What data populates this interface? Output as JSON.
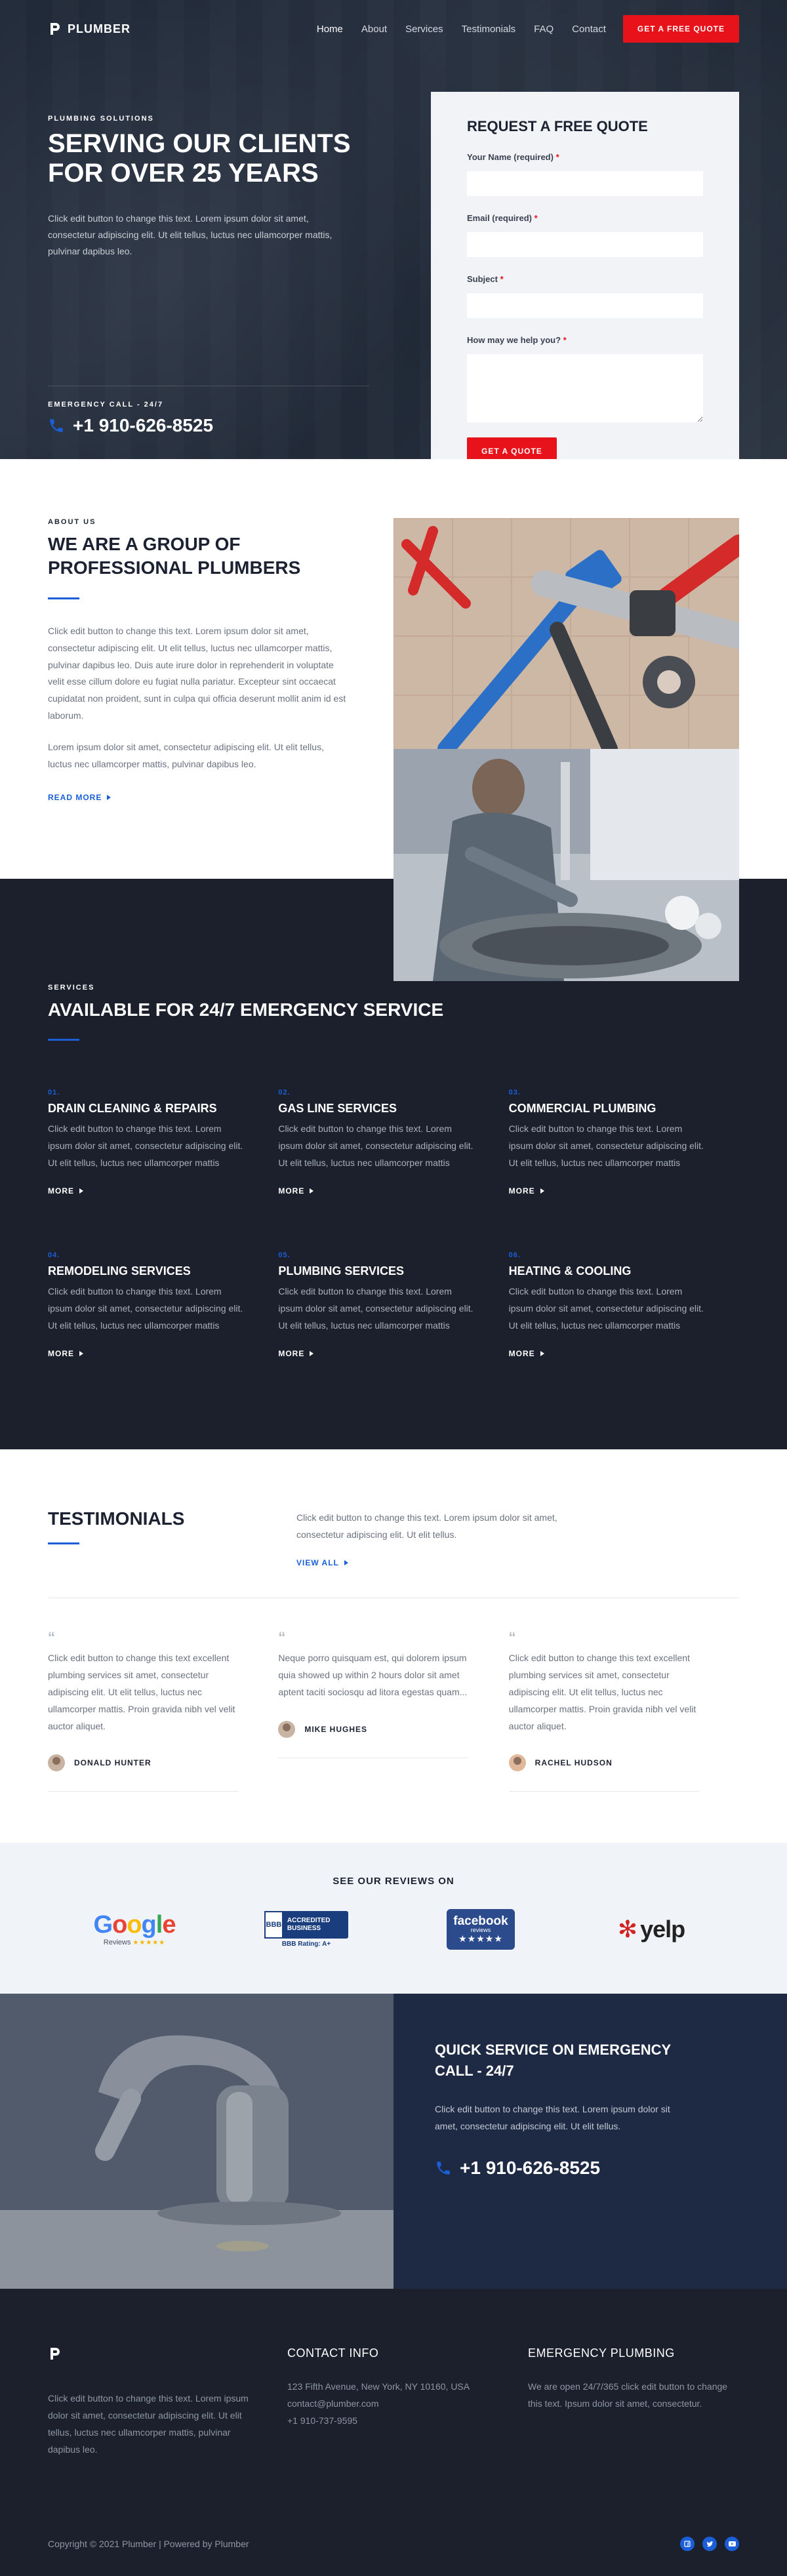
{
  "nav": {
    "brand": "PLUMBER",
    "links": [
      "Home",
      "About",
      "Services",
      "Testimonials",
      "FAQ",
      "Contact"
    ],
    "cta": "GET A FREE QUOTE"
  },
  "hero": {
    "eyebrow": "PLUMBING SOLUTIONS",
    "title": "SERVING OUR CLIENTS FOR OVER 25 YEARS",
    "text": "Click edit button to change this text. Lorem ipsum dolor sit amet, consectetur adipiscing elit. Ut elit tellus, luctus nec ullamcorper mattis, pulvinar dapibus leo.",
    "call_label": "EMERGENCY CALL - 24/7",
    "phone": "+1 910-626-8525"
  },
  "quote_form": {
    "title": "REQUEST A FREE QUOTE",
    "fields": [
      {
        "label": "Your Name (required)",
        "req": "*"
      },
      {
        "label": "Email (required)",
        "req": "*"
      },
      {
        "label": "Subject",
        "req": "*"
      },
      {
        "label": "How may we help you?",
        "req": "*"
      }
    ],
    "submit": "GET A QUOTE"
  },
  "about": {
    "eyebrow": "ABOUT US",
    "title": "WE ARE A GROUP OF PROFESSIONAL PLUMBERS",
    "p1": "Click edit button to change this text. Lorem ipsum dolor sit amet, consectetur adipiscing elit. Ut elit tellus, luctus nec ullamcorper mattis, pulvinar dapibus leo. Duis aute irure dolor in reprehenderit in voluptate velit esse cillum dolore eu fugiat nulla pariatur. Excepteur sint occaecat cupidatat non proident, sunt in culpa qui officia deserunt mollit anim id est laborum.",
    "p2": "Lorem ipsum dolor sit amet, consectetur adipiscing elit. Ut elit tellus, luctus nec ullamcorper mattis, pulvinar dapibus leo.",
    "read_more": "READ MORE"
  },
  "services": {
    "eyebrow": "SERVICES",
    "title": "AVAILABLE FOR 24/7 EMERGENCY SERVICE",
    "items": [
      {
        "num": "01.",
        "title": "DRAIN CLEANING & REPAIRS",
        "text": "Click edit button to change this text. Lorem ipsum dolor sit amet, consectetur adipiscing elit. Ut elit tellus, luctus nec ullamcorper mattis",
        "more": "MORE"
      },
      {
        "num": "02.",
        "title": "GAS LINE SERVICES",
        "text": "Click edit button to change this text. Lorem ipsum dolor sit amet, consectetur adipiscing elit. Ut elit tellus, luctus nec ullamcorper mattis",
        "more": "MORE"
      },
      {
        "num": "03.",
        "title": "COMMERCIAL PLUMBING",
        "text": "Click edit button to change this text. Lorem ipsum dolor sit amet, consectetur adipiscing elit. Ut elit tellus, luctus nec ullamcorper mattis",
        "more": "MORE"
      },
      {
        "num": "04.",
        "title": "REMODELING SERVICES",
        "text": "Click edit button to change this text. Lorem ipsum dolor sit amet, consectetur adipiscing elit. Ut elit tellus, luctus nec ullamcorper mattis",
        "more": "MORE"
      },
      {
        "num": "05.",
        "title": "PLUMBING SERVICES",
        "text": "Click edit button to change this text. Lorem ipsum dolor sit amet, consectetur adipiscing elit. Ut elit tellus, luctus nec ullamcorper mattis",
        "more": "MORE"
      },
      {
        "num": "06.",
        "title": "HEATING & COOLING",
        "text": "Click edit button to change this text. Lorem ipsum dolor sit amet, consectetur adipiscing elit. Ut elit tellus, luctus nec ullamcorper mattis",
        "more": "MORE"
      }
    ]
  },
  "testimonials": {
    "title": "TESTIMONIALS",
    "intro": "Click edit button to change this text. Lorem ipsum dolor sit amet, consectetur adipiscing elit. Ut elit tellus.",
    "view_all": "VIEW ALL",
    "items": [
      {
        "quote": "Click edit button to change this text excellent plumbing services sit amet, consectetur adipiscing elit. Ut elit tellus, luctus nec ullamcorper mattis. Proin gravida nibh vel velit auctor aliquet.",
        "name": "DONALD HUNTER"
      },
      {
        "quote": "Neque porro quisquam est, qui dolorem ipsum quia showed up within 2 hours dolor sit amet aptent taciti sociosqu ad litora egestas quam...",
        "name": "MIKE HUGHES"
      },
      {
        "quote": "Click edit button to change this text excellent plumbing services sit amet, consectetur adipiscing elit. Ut elit tellus, luctus nec ullamcorper mattis. Proin gravida nibh vel velit auctor aliquet.",
        "name": "RACHEL HUDSON"
      }
    ]
  },
  "reviews": {
    "title": "SEE OUR REVIEWS ON",
    "google": {
      "word": "Google",
      "sub": "Reviews",
      "stars": "★★★★★"
    },
    "bbb": {
      "mark": "BBB",
      "text": "ACCREDITED BUSINESS",
      "rating": "BBB Rating: A+"
    },
    "facebook": {
      "word": "facebook",
      "sub": "reviews",
      "stars": "★★★★★"
    },
    "yelp": {
      "word": "yelp"
    }
  },
  "emergency": {
    "title": "QUICK SERVICE ON EMERGENCY CALL - 24/7",
    "text": "Click edit button to change this text. Lorem ipsum dolor sit amet, consectetur adipiscing elit. Ut elit tellus.",
    "phone": "+1 910-626-8525"
  },
  "footer": {
    "about": "Click edit button to change this text. Lorem ipsum dolor sit amet, consectetur adipiscing elit. Ut elit tellus, luctus nec ullamcorper mattis, pulvinar dapibus leo.",
    "contact_title": "CONTACT INFO",
    "address": "123 Fifth Avenue, New York, NY 10160, USA",
    "email": "contact@plumber.com",
    "phone": "+1 910-737-9595",
    "emergency_title": "EMERGENCY PLUMBING",
    "emergency_text": "We are open 24/7/365 click edit button to change this text. Ipsum dolor sit amet, consectetur.",
    "copyright": "Copyright © 2021 Plumber | Powered by Plumber"
  },
  "colors": {
    "accent": "#e8121b",
    "blue": "#1a5fd8",
    "dark": "#1b202c",
    "navy": "#1e2a44"
  }
}
